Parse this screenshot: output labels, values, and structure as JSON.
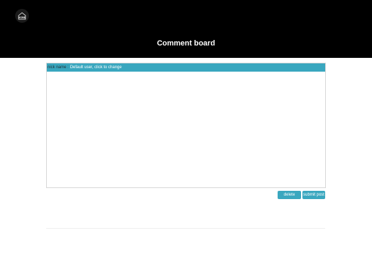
{
  "header": {
    "home_icon": "home-icon",
    "home_label": "HOME",
    "title": "Comment board"
  },
  "board": {
    "nick_label": "nick name :",
    "nick_value": "Default user, click to change",
    "comment_text": ""
  },
  "actions": {
    "delete_label": "delete",
    "submit_label": "submit post"
  },
  "colors": {
    "header_bg": "#000000",
    "accent": "#3aa7bf"
  }
}
